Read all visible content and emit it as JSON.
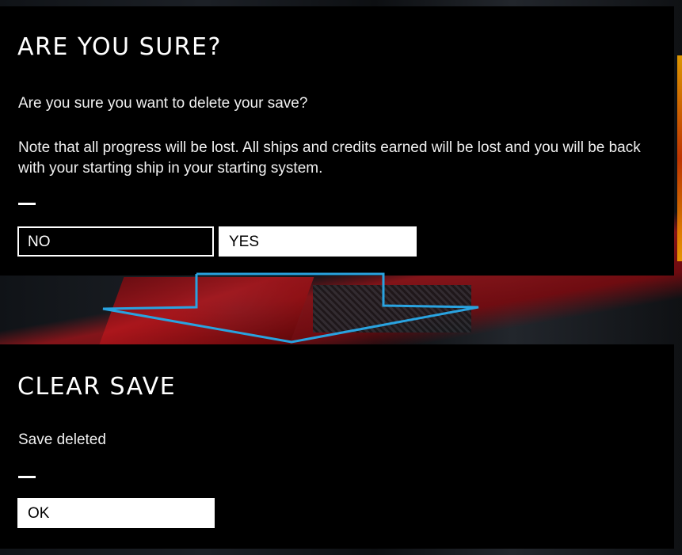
{
  "confirm_dialog": {
    "title": "ARE YOU SURE?",
    "question": "Are you sure you want to delete your save?",
    "note": "Note that all progress will be lost. All ships and credits earned will be lost and you will be back with your starting ship in your starting system.",
    "no_label": "NO",
    "yes_label": "YES"
  },
  "result_dialog": {
    "title": "CLEAR SAVE",
    "message": "Save deleted",
    "ok_label": "OK"
  },
  "colors": {
    "arrow": "#29a3e0",
    "background": "#000000",
    "text": "#ffffff"
  },
  "icons": {
    "transition_arrow": "arrow-down-icon"
  }
}
